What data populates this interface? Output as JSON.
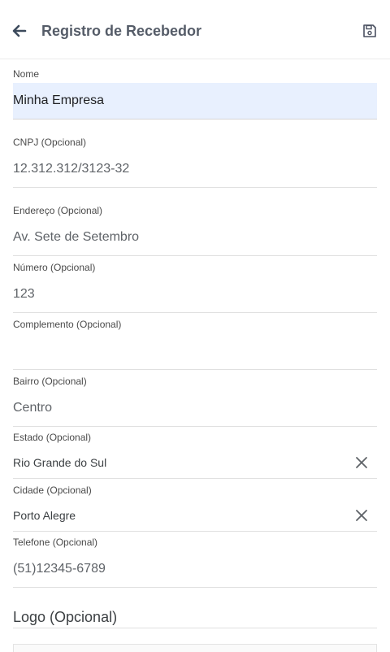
{
  "header": {
    "title": "Registro de Recebedor",
    "back_icon": "arrow-left-icon",
    "save_icon": "floppy-disk-icon"
  },
  "form": {
    "nome": {
      "label": "Nome",
      "value": "Minha Empresa"
    },
    "cnpj": {
      "label": "CNPJ (Opcional)",
      "value": "12.312.312/3123-32"
    },
    "endereco": {
      "label": "Endereço (Opcional)",
      "value": "Av. Sete de Setembro"
    },
    "numero": {
      "label": "Número (Opcional)",
      "value": "123"
    },
    "complemento": {
      "label": "Complemento (Opcional)",
      "value": ""
    },
    "bairro": {
      "label": "Bairro (Opcional)",
      "value": "Centro"
    },
    "estado": {
      "label": "Estado (Opcional)",
      "value": "Rio Grande do Sul",
      "clear_icon": "close-icon"
    },
    "cidade": {
      "label": "Cidade (Opcional)",
      "value": "Porto Alegre",
      "clear_icon": "close-icon"
    },
    "telefone": {
      "label": "Telefone (Opcional)",
      "value": "(51)12345-6789"
    }
  },
  "logo": {
    "title": "Logo (Opcional)"
  },
  "colors": {
    "accent_fill": "#e8f0fe",
    "title": "#555c68",
    "divider": "#e0e0e0"
  }
}
